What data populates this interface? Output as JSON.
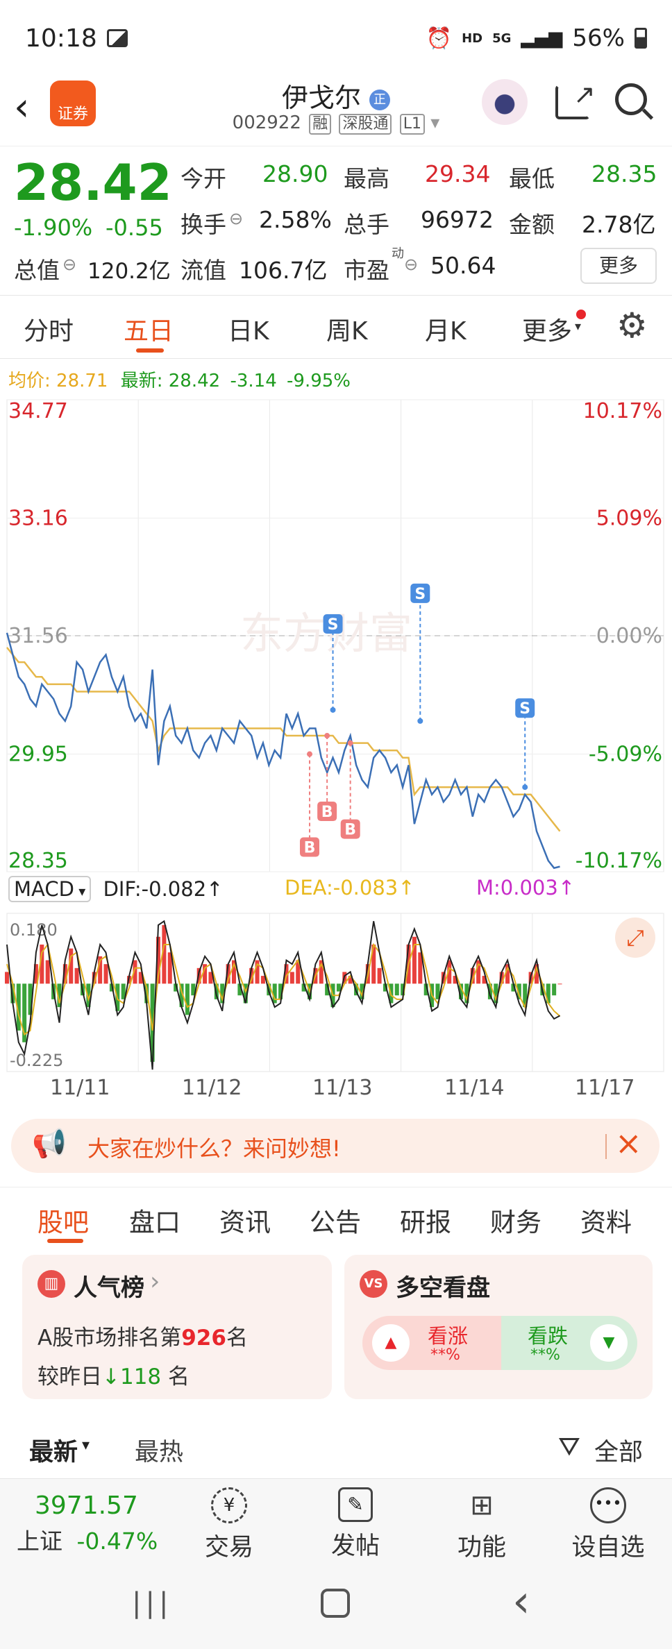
{
  "status": {
    "time": "10:18",
    "hd": "HD",
    "net": "5G",
    "battery": "56%"
  },
  "header": {
    "title": "伊戈尔",
    "title_badge": "正",
    "code": "002922",
    "tags": [
      "融",
      "深股通",
      "L1"
    ],
    "app_logo": "证券"
  },
  "quote": {
    "price": "28.42",
    "change_pct": "-1.90%",
    "change": "-0.55",
    "open_label": "今开",
    "open": "28.90",
    "high_label": "最高",
    "high": "29.34",
    "low_label": "最低",
    "low": "28.35",
    "turnover_label": "换手",
    "turnover": "2.58%",
    "volume_label": "总手",
    "volume": "96972",
    "amount_label": "金额",
    "amount": "2.78亿",
    "mktcap_label": "总值",
    "mktcap": "120.2亿",
    "float_label": "流值",
    "float": "106.7亿",
    "pe_label": "市盈",
    "pe_sup": "动",
    "pe": "50.64",
    "more_button": "更多"
  },
  "chart_tabs": [
    "分时",
    "五日",
    "日K",
    "周K",
    "月K",
    "更多"
  ],
  "chart_info": {
    "avg_label": "均价:",
    "avg": "28.71",
    "latest_label": "最新:",
    "latest": "28.42",
    "chg": "-3.14",
    "pct": "-9.95%"
  },
  "chart_data": {
    "type": "line",
    "title": "",
    "xlabel": "",
    "ylabel": "",
    "x_labels": [
      "11/11",
      "11/12",
      "11/13",
      "11/14",
      "11/17"
    ],
    "y_ticks_left": [
      "34.77",
      "33.16",
      "31.56",
      "29.95",
      "28.35"
    ],
    "y_ticks_right": [
      "10.17%",
      "5.09%",
      "0.00%",
      "-5.09%",
      "-10.17%"
    ],
    "ylim": [
      28.35,
      34.77
    ],
    "prev_close": 31.56,
    "grid": true,
    "watermark": "东方财富",
    "series": [
      {
        "name": "最新",
        "values": [
          31.6,
          31.3,
          31.0,
          30.9,
          30.7,
          30.6,
          30.9,
          30.8,
          30.7,
          30.5,
          30.4,
          30.6,
          31.2,
          31.1,
          30.8,
          31.0,
          31.2,
          31.3,
          31.0,
          30.8,
          31.0,
          30.6,
          30.4,
          30.5,
          30.3,
          31.1,
          29.8,
          30.4,
          30.6,
          30.2,
          30.1,
          30.3,
          30.0,
          29.9,
          30.1,
          30.2,
          30.0,
          30.3,
          30.2,
          30.1,
          30.4,
          30.3,
          30.2,
          29.9,
          30.1,
          29.8,
          30.0,
          29.9,
          30.5,
          30.3,
          30.5,
          30.2,
          30.3,
          30.3,
          29.9,
          29.7,
          29.9,
          29.7,
          30.0,
          30.2,
          29.8,
          29.6,
          29.5,
          29.9,
          30.0,
          29.9,
          29.7,
          29.8,
          29.5,
          29.8,
          29.0,
          29.3,
          29.6,
          29.4,
          29.5,
          29.3,
          29.4,
          29.6,
          29.4,
          29.5,
          29.1,
          29.4,
          29.3,
          29.5,
          29.6,
          29.5,
          29.3,
          29.1,
          29.2,
          29.4,
          29.3,
          28.9,
          28.7,
          28.5,
          28.4,
          28.42
        ]
      },
      {
        "name": "均价",
        "values": [
          31.4,
          31.3,
          31.2,
          31.2,
          31.1,
          31.0,
          31.0,
          30.9,
          30.9,
          30.9,
          30.9,
          30.9,
          30.8,
          30.8,
          30.8,
          30.8,
          30.8,
          30.8,
          30.8,
          30.8,
          30.8,
          30.8,
          30.7,
          30.6,
          30.5,
          30.4,
          30.0,
          30.2,
          30.3,
          30.3,
          30.3,
          30.3,
          30.3,
          30.3,
          30.3,
          30.3,
          30.3,
          30.3,
          30.3,
          30.3,
          30.3,
          30.3,
          30.3,
          30.3,
          30.3,
          30.3,
          30.3,
          30.3,
          30.2,
          30.2,
          30.2,
          30.2,
          30.2,
          30.2,
          30.2,
          30.2,
          30.2,
          30.1,
          30.1,
          30.1,
          30.1,
          30.1,
          30.1,
          30.0,
          30.0,
          30.0,
          30.0,
          30.0,
          29.9,
          29.9,
          29.4,
          29.5,
          29.5,
          29.5,
          29.5,
          29.5,
          29.5,
          29.5,
          29.5,
          29.5,
          29.5,
          29.5,
          29.5,
          29.5,
          29.5,
          29.5,
          29.5,
          29.4,
          29.4,
          29.4,
          29.4,
          29.3,
          29.2,
          29.1,
          29.0,
          28.9
        ]
      }
    ],
    "trade_markers": [
      {
        "label": "S",
        "day": "11/13"
      },
      {
        "label": "S",
        "day": "11/13"
      },
      {
        "label": "S",
        "day": "11/14"
      },
      {
        "label": "B",
        "day": "11/13"
      },
      {
        "label": "B",
        "day": "11/13"
      },
      {
        "label": "B",
        "day": "11/13"
      }
    ]
  },
  "macd": {
    "name": "MACD",
    "dif_label": "DIF:",
    "dif": "-0.082",
    "dea_label": "DEA:",
    "dea": "-0.083",
    "m_label": "M:",
    "m": "0.003",
    "ymax": "0.180",
    "ymin": "-0.225",
    "hist": [
      0.03,
      -0.05,
      -0.12,
      -0.15,
      -0.08,
      0.05,
      0.1,
      0.06,
      -0.04,
      -0.06,
      0.05,
      0.09,
      0.04,
      -0.03,
      -0.06,
      0.03,
      0.07,
      0.05,
      -0.02,
      -0.07,
      -0.04,
      0.02,
      0.06,
      0.03,
      -0.05,
      -0.2,
      0.12,
      0.15,
      0.08,
      -0.02,
      -0.06,
      -0.08,
      -0.03,
      0.04,
      0.05,
      0.03,
      -0.04,
      -0.05,
      0.05,
      0.06,
      -0.03,
      -0.05,
      0.04,
      0.06,
      0.02,
      -0.03,
      -0.05,
      -0.04,
      0.05,
      0.03,
      0.06,
      -0.02,
      -0.04,
      0.04,
      0.06,
      -0.03,
      -0.06,
      -0.02,
      0.03,
      0.02,
      -0.03,
      -0.04,
      0.05,
      0.1,
      0.04,
      -0.02,
      -0.05,
      -0.03,
      -0.03,
      0.1,
      0.12,
      0.08,
      -0.03,
      -0.06,
      -0.04,
      0.03,
      0.06,
      0.02,
      -0.04,
      -0.05,
      0.04,
      0.06,
      0.02,
      -0.04,
      -0.05,
      0.03,
      0.05,
      -0.02,
      -0.04,
      -0.06,
      0.03,
      0.05,
      -0.03,
      -0.05,
      -0.03,
      0.0
    ],
    "dif_line": [
      0.1,
      -0.05,
      -0.15,
      -0.18,
      -0.1,
      0.08,
      0.15,
      0.1,
      -0.02,
      -0.1,
      0.06,
      0.12,
      0.08,
      -0.02,
      -0.08,
      0.03,
      0.1,
      0.08,
      0.0,
      -0.08,
      -0.06,
      0.02,
      0.08,
      0.05,
      -0.05,
      -0.22,
      0.15,
      0.16,
      0.1,
      0.0,
      -0.06,
      -0.1,
      -0.05,
      0.03,
      0.07,
      0.05,
      -0.03,
      -0.07,
      0.05,
      0.08,
      0.0,
      -0.05,
      0.04,
      0.08,
      0.04,
      -0.02,
      -0.06,
      -0.05,
      0.06,
      0.05,
      0.08,
      0.0,
      -0.04,
      0.05,
      0.08,
      0.0,
      -0.06,
      -0.04,
      0.02,
      0.03,
      -0.02,
      -0.05,
      0.05,
      0.16,
      0.08,
      0.0,
      -0.06,
      -0.05,
      -0.04,
      0.1,
      0.14,
      0.1,
      0.0,
      -0.07,
      -0.06,
      0.02,
      0.07,
      0.03,
      -0.04,
      -0.06,
      0.04,
      0.07,
      0.03,
      -0.03,
      -0.06,
      0.03,
      0.06,
      0.0,
      -0.05,
      -0.08,
      0.02,
      0.06,
      -0.02,
      -0.07,
      -0.09,
      -0.082
    ],
    "dea_line": [
      0.05,
      0.0,
      -0.08,
      -0.13,
      -0.12,
      -0.02,
      0.08,
      0.1,
      0.03,
      -0.05,
      0.0,
      0.07,
      0.08,
      0.02,
      -0.04,
      0.0,
      0.06,
      0.07,
      0.02,
      -0.04,
      -0.05,
      -0.01,
      0.04,
      0.04,
      -0.01,
      -0.12,
      0.02,
      0.1,
      0.1,
      0.04,
      -0.02,
      -0.06,
      -0.05,
      0.0,
      0.04,
      0.05,
      0.0,
      -0.04,
      0.01,
      0.05,
      0.02,
      -0.02,
      0.01,
      0.05,
      0.04,
      0.0,
      -0.04,
      -0.04,
      0.02,
      0.04,
      0.06,
      0.02,
      -0.02,
      0.02,
      0.05,
      0.02,
      -0.03,
      -0.03,
      0.0,
      0.02,
      0.0,
      -0.03,
      0.02,
      0.1,
      0.08,
      0.03,
      -0.03,
      -0.04,
      -0.04,
      0.05,
      0.1,
      0.1,
      0.04,
      -0.03,
      -0.05,
      -0.01,
      0.04,
      0.03,
      -0.01,
      -0.04,
      0.01,
      0.05,
      0.04,
      0.0,
      -0.04,
      0.0,
      0.04,
      0.02,
      -0.03,
      -0.06,
      -0.01,
      0.04,
      0.0,
      -0.05,
      -0.07,
      -0.083
    ]
  },
  "promo": {
    "text": "大家在炒什么？来问妙想!"
  },
  "section_tabs": [
    "股吧",
    "盘口",
    "资讯",
    "公告",
    "研报",
    "财务",
    "资料"
  ],
  "popularity": {
    "title": "人气榜",
    "line1_prefix": "A股市场排名第",
    "rank": "926",
    "line1_suffix": "名",
    "line2_prefix": "较昨日",
    "delta": "118",
    "line2_suffix": "名"
  },
  "sentiment": {
    "title": "多空看盘",
    "up_label": "看涨",
    "up_value": "**%",
    "down_label": "看跌",
    "down_value": "**%"
  },
  "feed": {
    "latest": "最新",
    "hottest": "最热",
    "filter": "全部"
  },
  "bottom": {
    "index_value": "3971.57",
    "index_name": "上证",
    "index_pct": "-0.47%",
    "items": [
      "交易",
      "发帖",
      "功能",
      "设自选"
    ]
  }
}
